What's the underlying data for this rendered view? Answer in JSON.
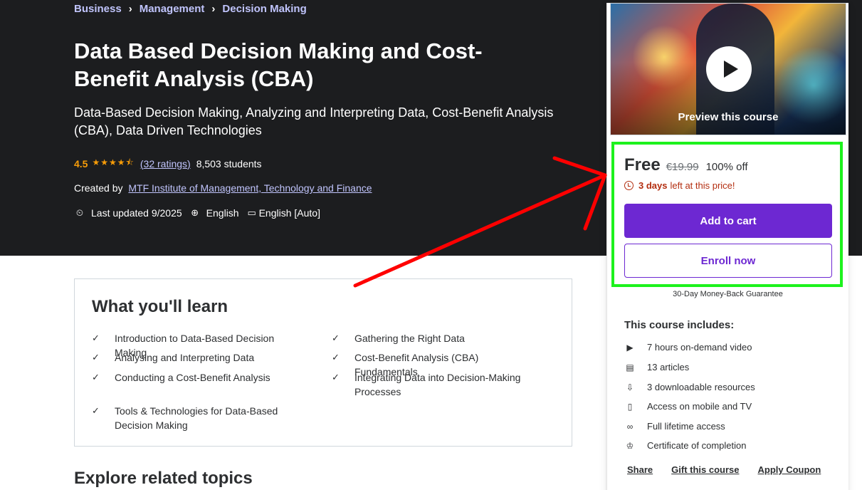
{
  "breadcrumb": {
    "items": [
      "Business",
      "Management",
      "Decision Making"
    ],
    "separator": "›"
  },
  "course": {
    "title": "Data Based Decision Making and Cost-Benefit Analysis (CBA)",
    "subtitle": "Data-Based Decision Making, Analyzing and Interpreting Data, Cost-Benefit Analysis (CBA), Data Driven Technologies",
    "rating": "4.5",
    "stars_value": 4.5,
    "ratings_link": "(32 ratings)",
    "students": "8,503 students",
    "created_by_label": "Created by",
    "creator": "MTF Institute of Management, Technology and Finance",
    "last_updated": "Last updated 9/2025",
    "language": "English",
    "captions": "English [Auto]"
  },
  "learn": {
    "title": "What you'll learn",
    "items": [
      "Introduction to Data-Based Decision Making",
      "Gathering the Right Data",
      "Analysing and Interpreting Data",
      "Cost-Benefit Analysis (CBA) Fundamentals",
      "Conducting a Cost-Benefit Analysis",
      "Integrating Data into Decision-Making Processes",
      "Tools & Technologies for Data-Based Decision Making"
    ]
  },
  "related": {
    "title": "Explore related topics"
  },
  "sidebar": {
    "preview_label": "Preview this course",
    "price": "Free",
    "original_price": "€19.99",
    "discount": "100% off",
    "timer_bold": "3 days",
    "timer_rest": "left at this price!",
    "add_to_cart": "Add to cart",
    "enroll_now": "Enroll now",
    "guarantee": "30-Day Money-Back Guarantee",
    "includes_title": "This course includes:",
    "includes": [
      "7 hours on-demand video",
      "13 articles",
      "3 downloadable resources",
      "Access on mobile and TV",
      "Full lifetime access",
      "Certificate of completion"
    ],
    "links": [
      "Share",
      "Gift this course",
      "Apply Coupon"
    ]
  },
  "colors": {
    "hero_bg": "#1c1d1f",
    "accent_purple": "#6d28d2",
    "link_lavender": "#c0c4fc",
    "star": "#f69c08",
    "timer_red": "#b32d0f",
    "highlight_green": "#1df21d",
    "annotation_red": "#ff0000"
  },
  "icons": {
    "breadcrumb_separator": "chevron-right-icon",
    "last_updated": "alert-clock-icon",
    "language": "globe-icon",
    "captions": "closed-captions-icon",
    "learn_item": "check-icon",
    "preview": "play-icon",
    "timer": "alarm-clock-icon",
    "includes": [
      "video-icon",
      "article-icon",
      "download-file-icon",
      "mobile-icon",
      "infinity-icon",
      "trophy-icon"
    ]
  }
}
